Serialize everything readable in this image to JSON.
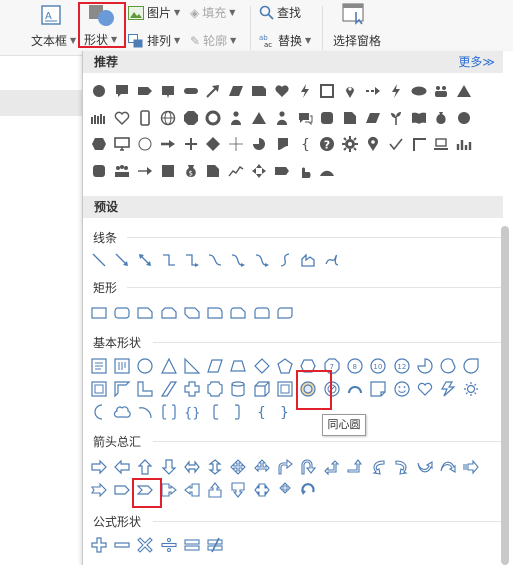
{
  "ribbon": {
    "textbox_label": "文本框",
    "shape_label": "形状",
    "picture_label": "图片",
    "fill_label": "填充",
    "arrange_label": "排列",
    "outline_label": "轮廓",
    "find_label": "查找",
    "replace_label": "替换",
    "selection_pane_label": "选择窗格"
  },
  "panel": {
    "recommended_title": "推荐",
    "more_label": "更多≫",
    "preset_title": "预设",
    "categories": {
      "lines": "线条",
      "rectangles": "矩形",
      "basic": "基本形状",
      "arrows": "箭头总汇",
      "equations": "公式形状"
    },
    "tooltip": "同心圆"
  },
  "colors": {
    "icon_dark": "#555555",
    "icon_blue": "#4d7db5",
    "highlight_red": "#e0202c",
    "link_blue": "#2a6fd6",
    "section_header_bg": "#ebebeb"
  }
}
